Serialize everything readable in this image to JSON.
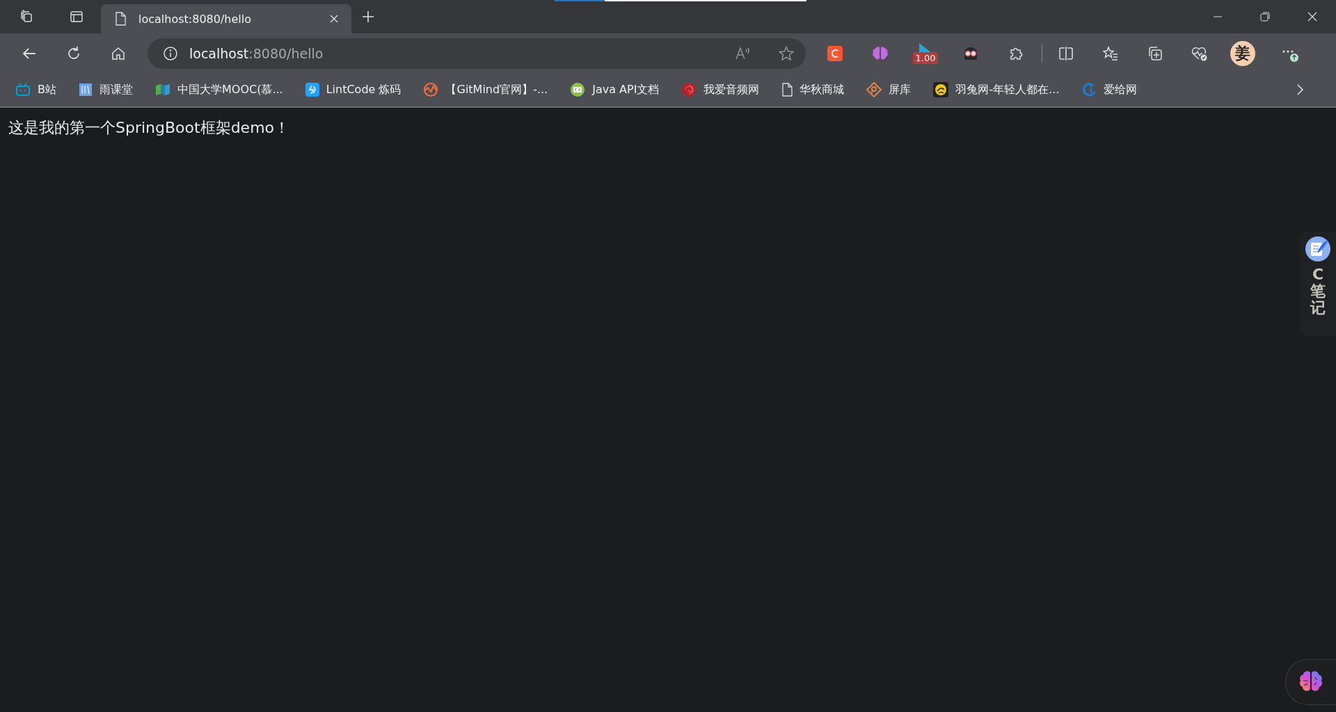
{
  "tabs": [
    {
      "title": "localhost:8080/hello",
      "selected": true
    }
  ],
  "address": {
    "host": "localhost",
    "path": ":8080/hello"
  },
  "extension_badge": "1.00",
  "profile": {
    "initial": "姜"
  },
  "bookmarks": [
    {
      "label": "B站"
    },
    {
      "label": "雨课堂"
    },
    {
      "label": "中国大学MOOC(慕..."
    },
    {
      "label": "LintCode 炼码"
    },
    {
      "label": "【GitMind官网】-..."
    },
    {
      "label": "Java API文档"
    },
    {
      "label": "我爱音频网"
    },
    {
      "label": "华秋商城"
    },
    {
      "label": "屏库"
    },
    {
      "label": "羽兔网-年轻人都在..."
    },
    {
      "label": "爱给网"
    }
  ],
  "page": {
    "text": "这是我的第一个SpringBoot框架demo！"
  },
  "side_widget": {
    "label": "C笔记"
  }
}
